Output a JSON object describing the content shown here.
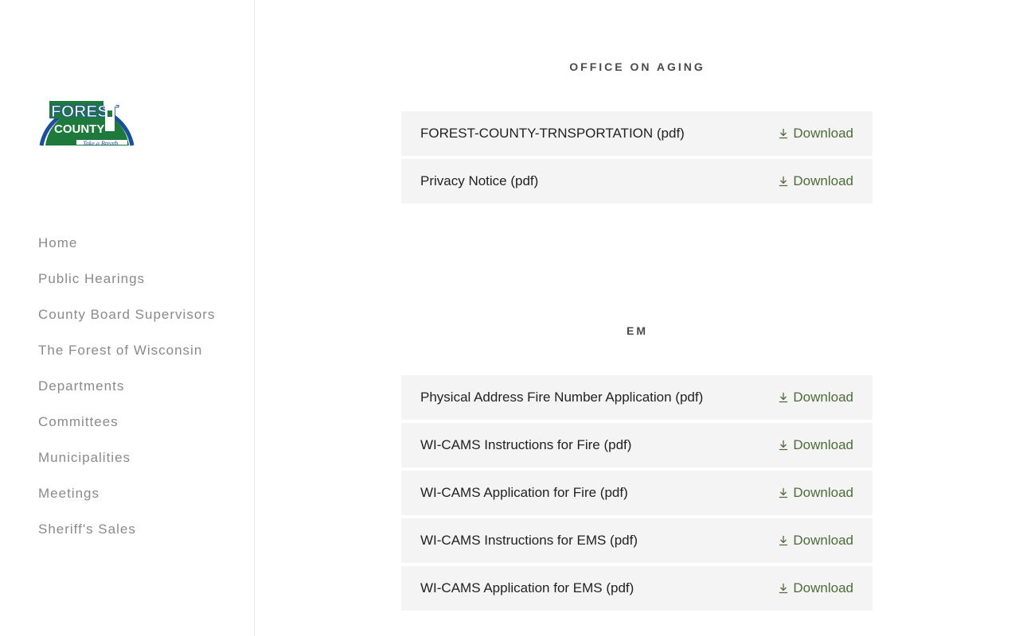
{
  "logo": {
    "top_text": "FOREST",
    "bottom_text": "COUNTY",
    "tagline": "Take a Breath",
    "colors": {
      "green": "#1e7a3c",
      "blue": "#1b4f9b"
    }
  },
  "nav": {
    "items": [
      {
        "label": "Home"
      },
      {
        "label": "Public Hearings"
      },
      {
        "label": "County Board Supervisors"
      },
      {
        "label": "The Forest of Wisconsin"
      },
      {
        "label": "Departments"
      },
      {
        "label": "Committees"
      },
      {
        "label": "Municipalities"
      },
      {
        "label": "Meetings"
      },
      {
        "label": "Sheriff's Sales"
      }
    ]
  },
  "sections": [
    {
      "title": "OFFICE ON AGING",
      "files": [
        {
          "name": "FOREST-COUNTY-TRNSPORTATION (pdf)",
          "action": "Download"
        },
        {
          "name": "Privacy Notice (pdf)",
          "action": "Download"
        }
      ]
    },
    {
      "title": "EM",
      "files": [
        {
          "name": "Physical Address Fire Number Application (pdf)",
          "action": "Download"
        },
        {
          "name": "WI-CAMS Instructions for Fire (pdf)",
          "action": "Download"
        },
        {
          "name": "WI-CAMS Application for Fire (pdf)",
          "action": "Download"
        },
        {
          "name": "WI-CAMS Instructions for EMS (pdf)",
          "action": "Download"
        },
        {
          "name": "WI-CAMS Application for EMS (pdf)",
          "action": "Download"
        }
      ]
    }
  ],
  "icons": {
    "download": "download-arrow-icon"
  },
  "colors": {
    "link": "#4f6b3a",
    "row_bg": "#f4f4f4",
    "nav_text": "#8a8a8a"
  }
}
